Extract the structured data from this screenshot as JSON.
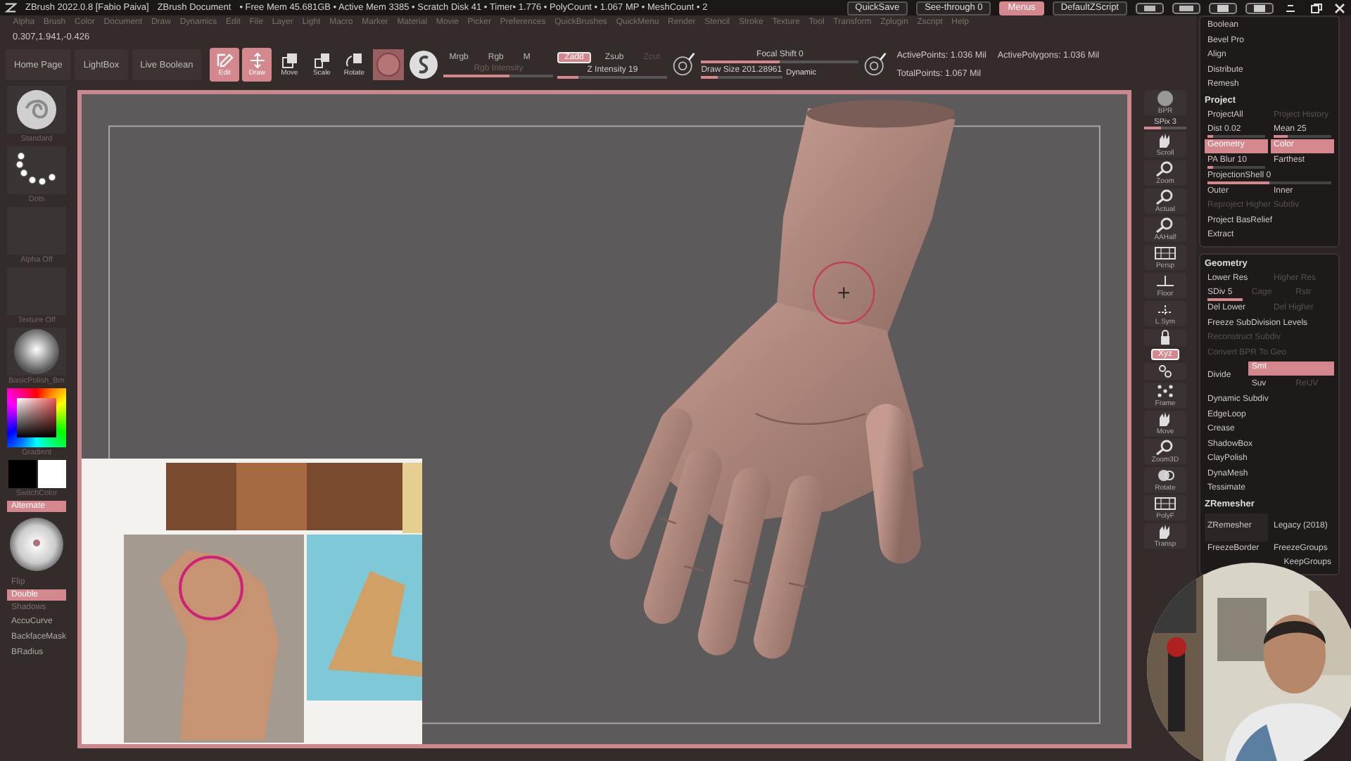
{
  "title_bar": {
    "items": [
      "ZBrush 2022.0.8 [Fabio Paiva]",
      "ZBrush Document",
      "• Free Mem 45.681GB • Active Mem 3385 • Scratch Disk 41 • Timer• 1.776 • PolyCount • 1.067 MP • MeshCount • 2"
    ],
    "controls": [
      {
        "label": "QuickSave",
        "on": false
      },
      {
        "label": "See-through 0",
        "on": false
      },
      {
        "label": "Menus",
        "on": true
      },
      {
        "label": "DefaultZScript",
        "on": false
      }
    ]
  },
  "menu_bar": [
    "Alpha",
    "Brush",
    "Color",
    "Document",
    "Draw",
    "Dynamics",
    "Edit",
    "File",
    "Layer",
    "Light",
    "Macro",
    "Marker",
    "Material",
    "Movie",
    "Picker",
    "Preferences",
    "QuickBrushes",
    "QuickMenu",
    "Render",
    "Stencil",
    "Stroke",
    "Texture",
    "Tool",
    "Transform",
    "Zplugin",
    "Zscript",
    "Help"
  ],
  "coordinates": "0.307,1.941,-0.426",
  "toolbar": {
    "shelf_buttons": [
      "Home Page",
      "LightBox",
      "Live Boolean"
    ],
    "tools": [
      {
        "kind": "edit",
        "label": "Edit",
        "on": true
      },
      {
        "kind": "draw",
        "label": "Draw",
        "on": true
      },
      {
        "kind": "move",
        "label": "Move",
        "on": false
      },
      {
        "kind": "scale",
        "label": "Scale",
        "on": false
      },
      {
        "kind": "rotate",
        "label": "Rotate",
        "on": false
      }
    ],
    "color_modes": [
      {
        "label": "Mrgb",
        "on": false
      },
      {
        "label": "Rgb",
        "on": false
      },
      {
        "label": "M",
        "on": false
      }
    ],
    "rgb_intensity": {
      "label": "Rgb Intensity",
      "level": 0.6
    },
    "z_modes": [
      {
        "label": "Zadd",
        "on": true
      },
      {
        "label": "Zsub",
        "on": false
      },
      {
        "label": "Zcut",
        "on": false
      }
    ],
    "z_intensity": {
      "label": "Z Intensity 19",
      "level": 0.19
    },
    "focal_shift": {
      "label": "Focal Shift 0",
      "level": 0.5
    },
    "draw_size": {
      "label": "Draw Size 201.28961",
      "level": 0.2
    },
    "dynamic": "Dynamic",
    "stats": [
      "ActivePoints: 1.036 Mil",
      "ActivePolygons: 1.036 Mil",
      "TotalPoints: 1.067 Mil"
    ]
  },
  "left_shelf": [
    {
      "kind": "brush",
      "label": "Standard"
    },
    {
      "kind": "stroke",
      "label": "Dots"
    },
    {
      "kind": "empty",
      "label": "Alpha Off"
    },
    {
      "kind": "empty",
      "label": "Texture Off"
    },
    {
      "kind": "material",
      "label": "BasicPolish_Bm"
    },
    {
      "kind": "picker",
      "label": "Gradient"
    },
    {
      "kind": "swatches",
      "label": "SwitchColor"
    },
    {
      "kind": "toggle",
      "label": "Alternate",
      "on": true
    },
    {
      "kind": "preview"
    },
    {
      "kind": "toggle",
      "label": "Flip",
      "on": false
    },
    {
      "kind": "toggle",
      "label": "Double",
      "on": true
    },
    {
      "kind": "toggle",
      "label": "Shadows",
      "on": false
    },
    {
      "kind": "text",
      "label": "AccuCurve"
    },
    {
      "kind": "text",
      "label": "BackfaceMask"
    },
    {
      "kind": "text",
      "label": "BRadius"
    }
  ],
  "right_tools": [
    {
      "kind": "sphere",
      "label": "BPR"
    },
    {
      "kind": "slider",
      "label": "SPix 3",
      "level": 0.4
    },
    {
      "kind": "hand",
      "label": "Scroll"
    },
    {
      "kind": "magnifier",
      "label": "Zoom"
    },
    {
      "kind": "magnifier",
      "label": "Actual"
    },
    {
      "kind": "magnifier",
      "label": "AAHalf"
    },
    {
      "kind": "grid",
      "label": "Persp"
    },
    {
      "kind": "floor",
      "label": "Floor"
    },
    {
      "kind": "sym",
      "label": "L.Sym"
    },
    {
      "kind": "lock"
    },
    {
      "kind": "toggle",
      "label": "Xyz",
      "on": true
    },
    {
      "kind": "axes"
    },
    {
      "kind": "dots",
      "label": "Frame"
    },
    {
      "kind": "hand",
      "label": "Move"
    },
    {
      "kind": "magnifier",
      "label": "Zoom3D"
    },
    {
      "kind": "rotate",
      "label": "Rotate"
    },
    {
      "kind": "grid",
      "label": "PolyF"
    },
    {
      "kind": "hand",
      "label": "Transp"
    }
  ],
  "tool_panel": {
    "sections": [
      {
        "rows": [
          {
            "kind": "row",
            "items": [
              {
                "kind": "button",
                "label": "Boolean",
                "on": false,
                "disabled": false
              }
            ]
          },
          {
            "kind": "row",
            "items": [
              {
                "kind": "button",
                "label": "Bevel Pro",
                "on": false,
                "disabled": false
              }
            ]
          },
          {
            "kind": "row",
            "items": [
              {
                "kind": "button",
                "label": "Align",
                "on": false,
                "disabled": false
              }
            ]
          },
          {
            "kind": "row",
            "items": [
              {
                "kind": "button",
                "label": "Distribute",
                "on": false,
                "disabled": false
              }
            ]
          },
          {
            "kind": "row",
            "items": [
              {
                "kind": "button",
                "label": "Remesh",
                "on": false,
                "disabled": false
              }
            ]
          },
          {
            "kind": "header",
            "label": "Project"
          },
          {
            "kind": "row",
            "items": [
              {
                "kind": "button",
                "label": "ProjectAll",
                "on": false,
                "disabled": false
              },
              {
                "kind": "button",
                "label": "Project History",
                "on": false,
                "disabled": true
              }
            ]
          },
          {
            "kind": "row",
            "items": [
              {
                "kind": "slider",
                "label": "Dist 0.02",
                "level": 0.1
              },
              {
                "kind": "slider",
                "label": "Mean 25",
                "level": 0.25
              }
            ]
          },
          {
            "kind": "row",
            "items": [
              {
                "kind": "button",
                "label": "Geometry",
                "on": true,
                "disabled": false
              },
              {
                "kind": "button",
                "label": "Color",
                "on": true,
                "disabled": false
              }
            ]
          },
          {
            "kind": "row",
            "items": [
              {
                "kind": "slider",
                "label": "PA Blur 10",
                "level": 0.1
              },
              {
                "kind": "button",
                "label": "Farthest",
                "on": false,
                "disabled": false
              }
            ]
          },
          {
            "kind": "row",
            "items": [
              {
                "kind": "slider",
                "label": "ProjectionShell 0",
                "level": 0.5
              }
            ]
          },
          {
            "kind": "row",
            "items": [
              {
                "kind": "button",
                "label": "Outer",
                "on": false,
                "disabled": false
              },
              {
                "kind": "button",
                "label": "Inner",
                "on": false,
                "disabled": false
              }
            ]
          },
          {
            "kind": "row",
            "items": [
              {
                "kind": "button",
                "label": "Reproject Higher Subdiv",
                "on": false,
                "disabled": true
              }
            ]
          },
          {
            "kind": "row",
            "items": [
              {
                "kind": "button",
                "label": "Project BasRelief",
                "on": false,
                "disabled": false
              }
            ]
          },
          {
            "kind": "row",
            "items": [
              {
                "kind": "button",
                "label": "Extract",
                "on": false,
                "disabled": false
              }
            ]
          }
        ]
      },
      {
        "rows": [
          {
            "kind": "header",
            "label": "Geometry"
          },
          {
            "kind": "row",
            "items": [
              {
                "kind": "button",
                "label": "Lower Res",
                "on": false,
                "disabled": false
              },
              {
                "kind": "button",
                "label": "Higher Res",
                "on": false,
                "disabled": true
              }
            ]
          },
          {
            "kind": "row",
            "items": [
              {
                "kind": "slider",
                "label": "SDiv 5",
                "level": 1
              },
              {
                "kind": "button",
                "label": "Cage",
                "on": false,
                "disabled": true
              },
              {
                "kind": "button",
                "label": "Rstr",
                "on": false,
                "disabled": true
              }
            ]
          },
          {
            "kind": "row",
            "items": [
              {
                "kind": "button",
                "label": "Del Lower",
                "on": false,
                "disabled": false
              },
              {
                "kind": "button",
                "label": "Del Higher",
                "on": false,
                "disabled": true
              }
            ]
          },
          {
            "kind": "row",
            "items": [
              {
                "kind": "button",
                "label": "Freeze SubDivision Levels",
                "on": false,
                "disabled": false
              }
            ]
          },
          {
            "kind": "row",
            "items": [
              {
                "kind": "button",
                "label": "Reconstruct Subdiv",
                "on": false,
                "disabled": true
              }
            ]
          },
          {
            "kind": "row",
            "items": [
              {
                "kind": "button",
                "label": "Convert BPR To Geo",
                "on": false,
                "disabled": true
              }
            ]
          },
          {
            "kind": "divide",
            "items": [
              {
                "kind": "button",
                "label": "Divide",
                "on": false,
                "disabled": false
              },
              {
                "kind": "button",
                "label": "Smt",
                "on": true,
                "disabled": false
              },
              {
                "kind": "button",
                "label": "Suv",
                "on": false,
                "disabled": false
              },
              {
                "kind": "button",
                "label": "ReUV",
                "on": false,
                "disabled": true
              }
            ]
          },
          {
            "kind": "row",
            "items": [
              {
                "kind": "button",
                "label": "Dynamic Subdiv",
                "on": false,
                "disabled": false
              }
            ]
          },
          {
            "kind": "row",
            "items": [
              {
                "kind": "button",
                "label": "EdgeLoop",
                "on": false,
                "disabled": false
              }
            ]
          },
          {
            "kind": "row",
            "items": [
              {
                "kind": "button",
                "label": "Crease",
                "on": false,
                "disabled": false
              }
            ]
          },
          {
            "kind": "row",
            "items": [
              {
                "kind": "button",
                "label": "ShadowBox",
                "on": false,
                "disabled": false
              }
            ]
          },
          {
            "kind": "row",
            "items": [
              {
                "kind": "button",
                "label": "ClayPolish",
                "on": false,
                "disabled": false
              }
            ]
          },
          {
            "kind": "row",
            "items": [
              {
                "kind": "button",
                "label": "DynaMesh",
                "on": false,
                "disabled": false
              }
            ]
          },
          {
            "kind": "row",
            "items": [
              {
                "kind": "button",
                "label": "Tessimate",
                "on": false,
                "disabled": false
              }
            ]
          },
          {
            "kind": "header",
            "label": "ZRemesher"
          },
          {
            "kind": "big",
            "items": [
              {
                "kind": "button",
                "label": "ZRemesher",
                "on": false,
                "disabled": false
              },
              {
                "kind": "button",
                "label": "Legacy (2018)",
                "on": false,
                "disabled": false
              }
            ]
          },
          {
            "kind": "row",
            "items": [
              {
                "kind": "button",
                "label": "FreezeBorder",
                "on": false,
                "disabled": false
              },
              {
                "kind": "button",
                "label": "FreezeGroups",
                "on": false,
                "disabled": false
              }
            ]
          },
          {
            "kind": "right",
            "items": [
              {
                "kind": "button",
                "label": "KeepGroups",
                "on": false,
                "disabled": false
              }
            ]
          }
        ]
      }
    ]
  }
}
